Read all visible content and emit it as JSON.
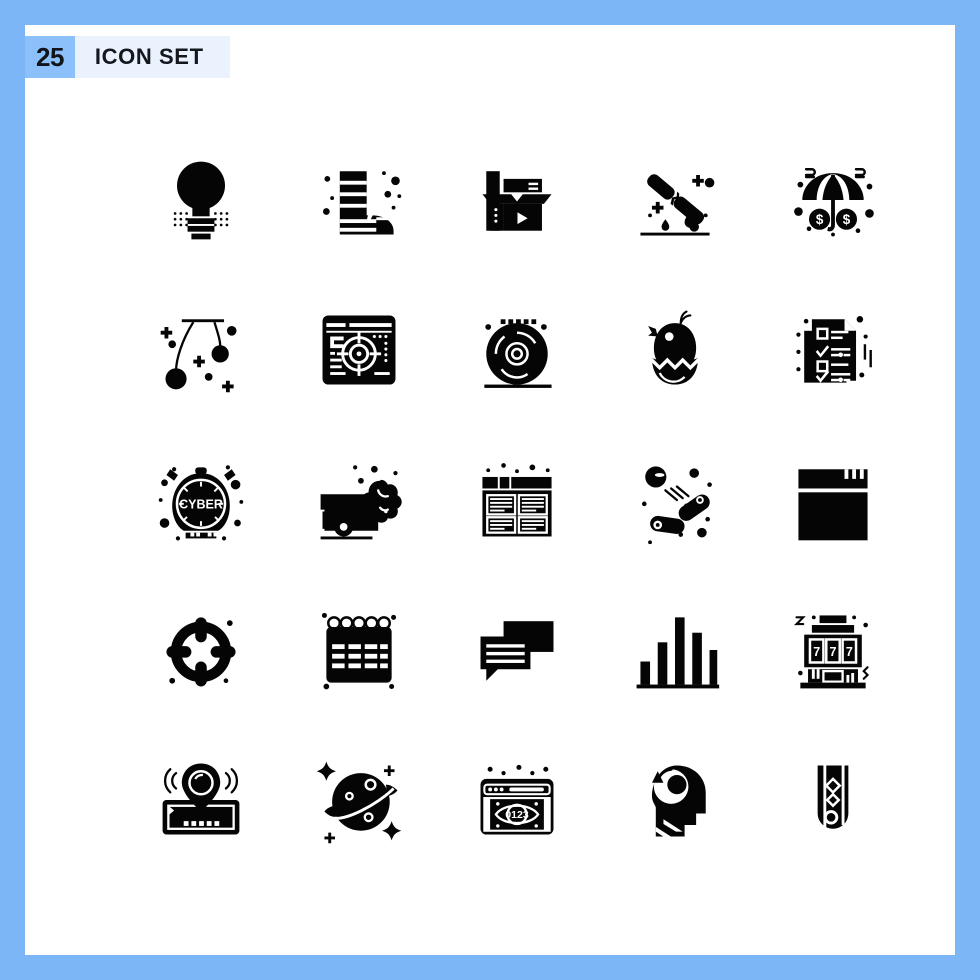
{
  "page": {
    "background_color": "#7cb6f7",
    "card_color": "#ffffff"
  },
  "header": {
    "count": "25",
    "title": "ICON SET",
    "badge_color": "#8cc0fa",
    "strip_color": "#e9f2fd",
    "text_color": "#14181d"
  },
  "grid": {
    "columns": 5,
    "rows": 5,
    "total_icons": 25,
    "icon_color": "#050505",
    "icons": [
      {
        "index": 1,
        "name": "idea-atom-bulb-icon",
        "label": "Light bulb with atom"
      },
      {
        "index": 2,
        "name": "rain-boot-icon",
        "label": "Rubber boot"
      },
      {
        "index": 3,
        "name": "video-package-box-icon",
        "label": "Open box with play button"
      },
      {
        "index": 4,
        "name": "sugar-cane-icon",
        "label": "Cut sugar cane with drops"
      },
      {
        "index": 5,
        "name": "money-insurance-umbrella-icon",
        "label": "Umbrella over dollar coins"
      },
      {
        "index": 6,
        "name": "hanging-ornaments-icon",
        "label": "Hanging baubles"
      },
      {
        "index": 7,
        "name": "browser-target-icon",
        "label": "Web page with crosshair target"
      },
      {
        "index": 8,
        "name": "vinyl-record-icon",
        "label": "Vinyl record turntable"
      },
      {
        "index": 9,
        "name": "hatching-chick-icon",
        "label": "Chick in cracked egg"
      },
      {
        "index": 10,
        "name": "checklist-document-icon",
        "label": "Checklist papers"
      },
      {
        "index": 11,
        "name": "cyber-alarm-clock-icon",
        "label": "Alarm clock reading CYBER"
      },
      {
        "index": 12,
        "name": "truck-pollution-icon",
        "label": "Truck with exhaust smoke"
      },
      {
        "index": 13,
        "name": "newspaper-layout-icon",
        "label": "Page layout grid"
      },
      {
        "index": 14,
        "name": "bacteria-germs-icon",
        "label": "Bacteria microbes"
      },
      {
        "index": 15,
        "name": "browser-window-solid-icon",
        "label": "Filled browser window"
      },
      {
        "index": 16,
        "name": "crosshair-target-icon",
        "label": "Target crosshair"
      },
      {
        "index": 17,
        "name": "spiral-calendar-icon",
        "label": "Spiral bound calendar"
      },
      {
        "index": 18,
        "name": "chat-bubbles-icon",
        "label": "Two chat bubbles"
      },
      {
        "index": 19,
        "name": "bar-chart-icon",
        "label": "Bar chart statistics"
      },
      {
        "index": 20,
        "name": "slot-machine-icon",
        "label": "Slot machine showing 777"
      },
      {
        "index": 21,
        "name": "map-location-signal-icon",
        "label": "Map pin with signal waves"
      },
      {
        "index": 22,
        "name": "planet-saturn-icon",
        "label": "Ringed planet with stars"
      },
      {
        "index": 23,
        "name": "browser-eye-data-icon",
        "label": "Browser with eye and 0123"
      },
      {
        "index": 24,
        "name": "head-awareness-icon",
        "label": "Head profile with eye"
      },
      {
        "index": 25,
        "name": "test-tube-icon",
        "label": "Test tube with particles"
      }
    ],
    "icon_texts": {
      "clock_face": "CYBER",
      "slot_reels": [
        "7",
        "7",
        "7"
      ],
      "browser_eye": "0123"
    }
  }
}
